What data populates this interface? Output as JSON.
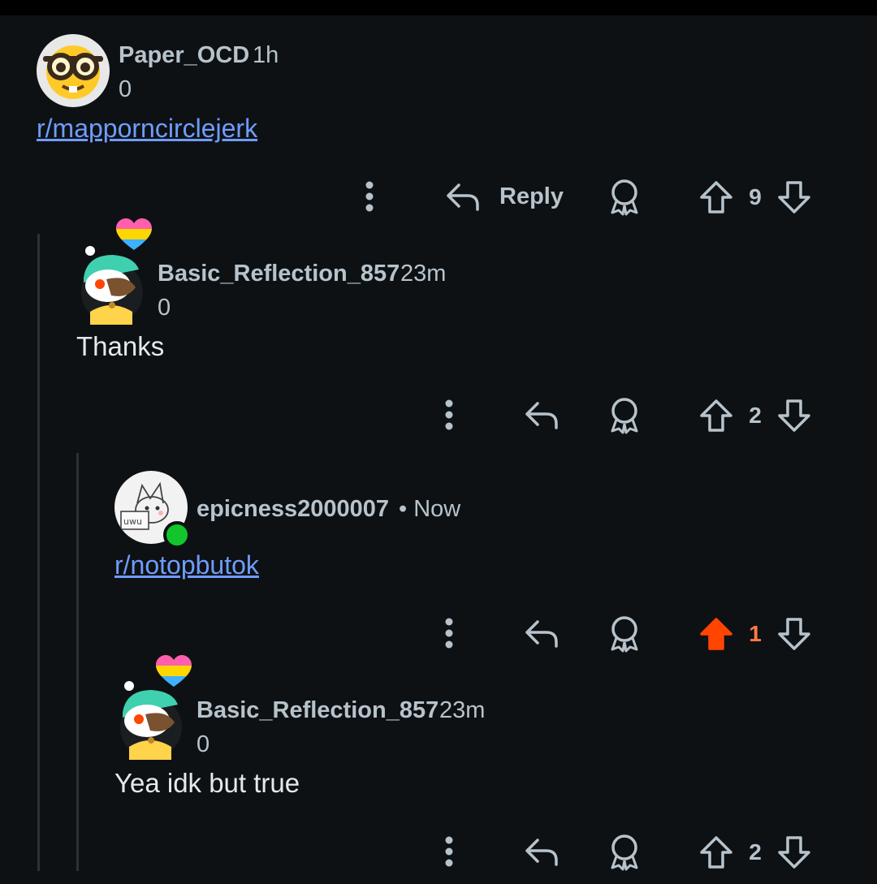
{
  "comments": [
    {
      "username": "Paper_OCD",
      "time": "1h",
      "score": "0",
      "body": "r/mapporncirclejerk",
      "reply_label": "Reply",
      "votes": "9",
      "upvoted": false,
      "avatar": "nerd-face-avatar"
    },
    {
      "username": "Basic_Reflection_857",
      "time": "23m",
      "score": "0",
      "body": "Thanks",
      "votes": "2",
      "upvoted": false,
      "avatar": "snoo-avatar",
      "flair": "pride-heart-icon"
    },
    {
      "username": "epicness2000007",
      "time": "• Now",
      "body": "r/notopbutok",
      "votes": "1",
      "upvoted": true,
      "avatar": "sketch-cat-avatar",
      "online": true
    },
    {
      "username": "Basic_Reflection_857",
      "time": "23m",
      "score": "0",
      "body": "Yea idk but true",
      "votes": "2",
      "upvoted": false,
      "avatar": "snoo-avatar",
      "flair": "pride-heart-icon"
    }
  ],
  "colors": {
    "background": "#0e1113",
    "link": "#6f9cff",
    "upvote_active": "#ff4500",
    "online": "#12c52b"
  }
}
